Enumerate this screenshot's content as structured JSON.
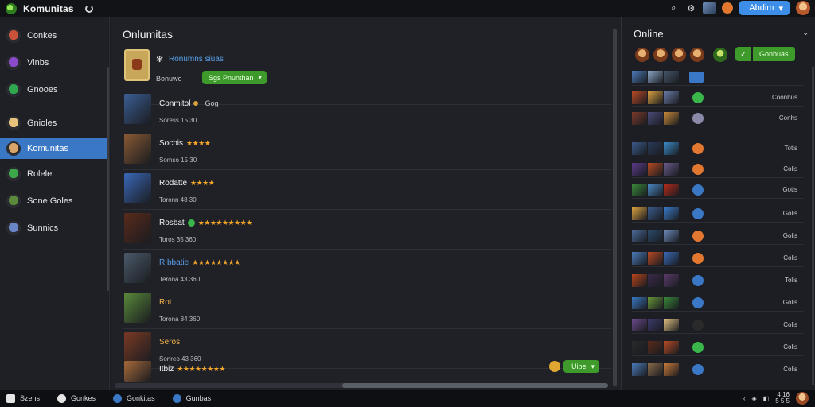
{
  "app": {
    "title": "Komunitas"
  },
  "topbar": {
    "button_label": "Abdim",
    "icons": [
      "search-icon",
      "settings-icon",
      "notification-icon",
      "chevron-down-icon"
    ]
  },
  "sidebar": {
    "items": [
      {
        "label": "Conkes",
        "color": "#c8533a"
      },
      {
        "label": "Vinbs",
        "color": "#8a4ac9"
      },
      {
        "label": "Gnooes",
        "color": "#2fa84f"
      },
      {
        "label": "Gnioles",
        "color": "#e7c27a"
      },
      {
        "label": "Komunitas",
        "color": "#d8a46a"
      },
      {
        "label": "Rolele",
        "color": "#3da84a"
      },
      {
        "label": "Sone Goles",
        "color": "#5b8a3a"
      },
      {
        "label": "Sunnics",
        "color": "#6a86c9"
      }
    ],
    "active_index": 4
  },
  "main": {
    "title": "Onlumitas",
    "featured": {
      "name": "Ronumns siuas",
      "subtitle": "Bonuwe",
      "badge": "Sgs Pnunthan"
    },
    "rows": [
      {
        "name": "Conmitol",
        "meta": "Soress 15 30",
        "tag": "Gog",
        "thumb": "#3b5e94"
      },
      {
        "name": "Socbis",
        "meta": "Somso 15 30",
        "stars": "★★★★",
        "thumb": "#8a5a34"
      },
      {
        "name": "Rodatte",
        "meta": "Toronn 48 30",
        "stars": "★★★★",
        "thumb": "#3a67b8"
      },
      {
        "name": "Rosbat",
        "meta": "Toros 35 360",
        "stars": "★★★★★★★★★",
        "thumb": "#5a2a1a"
      },
      {
        "name": "R bbatie",
        "meta": "Terona 43 360",
        "stars": "★★★★★★★★",
        "thumb": "#4a5a6a"
      },
      {
        "name": "Rot",
        "meta": "Torona 84 360",
        "thumb": "#5a8a3a"
      },
      {
        "name": "Seros",
        "meta": "Sonreo 43 360",
        "thumb": "#7a3a24"
      },
      {
        "name": "Itbiz",
        "meta": "",
        "stars": "★★★★★★★★",
        "button": "Uibe",
        "thumb": "#a86a3a"
      }
    ]
  },
  "right": {
    "title": "Online",
    "button": "Gonbuas",
    "friends": [
      {
        "status": "",
        "badge": "#3a78c6",
        "t": [
          "#4a7ab8",
          "#8aa6c8",
          "#44556a"
        ]
      },
      {
        "status": "Coonbus",
        "badge": "#39b54a",
        "t": [
          "#b84a24",
          "#d8a040",
          "#6a7aa8"
        ]
      },
      {
        "status": "Conhs",
        "badge": "#8a8aa8",
        "t": [
          "#7a3a2a",
          "#4a4a7a",
          "#c88a3a"
        ]
      },
      {
        "status": "Totis",
        "badge": "#e2772f",
        "t": [
          "#3a5a8a",
          "#2a3a5a",
          "#3a8ac8"
        ]
      },
      {
        "status": "Colis",
        "badge": "#e2772f",
        "t": [
          "#5a3a8a",
          "#b84a24",
          "#6a5a8a"
        ]
      },
      {
        "status": "Gotis",
        "badge": "#3a78c6",
        "t": [
          "#3a8a3a",
          "#4a8ac8",
          "#b82a1a"
        ]
      },
      {
        "status": "Golis",
        "badge": "#3a78c6",
        "t": [
          "#d8a040",
          "#3a5a8a",
          "#3a7ac8"
        ]
      },
      {
        "status": "Golis",
        "badge": "#e2772f",
        "t": [
          "#4a6a9a",
          "#2a4a6a",
          "#6a8ab8"
        ]
      },
      {
        "status": "Colis",
        "badge": "#e2772f",
        "t": [
          "#4a7ab8",
          "#b84a24",
          "#3a6ab8"
        ]
      },
      {
        "status": "Tolis",
        "badge": "#3a78c6",
        "t": [
          "#b8441a",
          "#3a2a4a",
          "#5a3a6a"
        ]
      },
      {
        "status": "Golis",
        "badge": "#3a78c6",
        "t": [
          "#3a7ac8",
          "#6a9a3a",
          "#3a8a3a"
        ]
      },
      {
        "status": "Colis",
        "badge": "#2a2a2a",
        "t": [
          "#6a4a8a",
          "#3a3a6a",
          "#e0c080"
        ]
      },
      {
        "status": "Colis",
        "badge": "#39b54a",
        "t": [
          "#2a2a2a",
          "#5a2a1a",
          "#b84a24"
        ]
      },
      {
        "status": "Colis",
        "badge": "#3a78c6",
        "t": [
          "#4a7ab8",
          "#8a6a4a",
          "#c87a3a"
        ]
      }
    ]
  },
  "bottombar": {
    "items": [
      {
        "label": "Szehs",
        "color": "#e4e4e4"
      },
      {
        "label": "Gonkes",
        "color": "#e4e4e4"
      },
      {
        "label": "Gonkitas",
        "color": "#3a78c6"
      },
      {
        "label": "Gunbas",
        "color": "#3a78c6"
      }
    ],
    "clock_line1": "4 16",
    "clock_line2": "5 5 5"
  }
}
